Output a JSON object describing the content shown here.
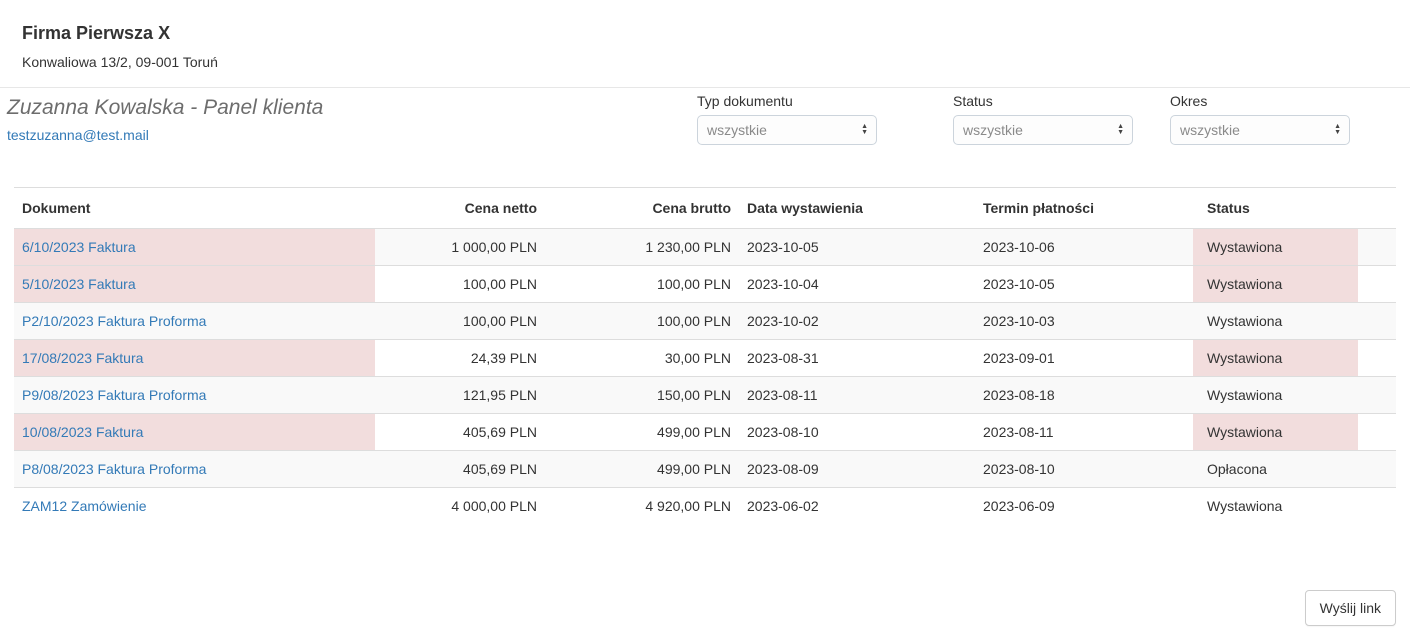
{
  "company": {
    "name": "Firma Pierwsza X",
    "address": "Konwaliowa 13/2, 09-001 Toruń"
  },
  "client": {
    "title": "Zuzanna Kowalska - Panel klienta",
    "email": "testzuzanna@test.mail"
  },
  "filters": [
    {
      "label": "Typ dokumentu",
      "value": "wszystkie"
    },
    {
      "label": "Status",
      "value": "wszystkie"
    },
    {
      "label": "Okres",
      "value": "wszystkie"
    }
  ],
  "table": {
    "columns": [
      "Dokument",
      "Cena netto",
      "Cena brutto",
      "Data wystawienia",
      "Termin płatności",
      "Status"
    ],
    "rows": [
      {
        "dokument": "6/10/2023 Faktura",
        "netto": "1 000,00 PLN",
        "brutto": "1 230,00 PLN",
        "wystawienie": "2023-10-05",
        "termin": "2023-10-06",
        "status": "Wystawiona",
        "overdue": true
      },
      {
        "dokument": "5/10/2023 Faktura",
        "netto": "100,00 PLN",
        "brutto": "100,00 PLN",
        "wystawienie": "2023-10-04",
        "termin": "2023-10-05",
        "status": "Wystawiona",
        "overdue": true
      },
      {
        "dokument": "P2/10/2023 Faktura Proforma",
        "netto": "100,00 PLN",
        "brutto": "100,00 PLN",
        "wystawienie": "2023-10-02",
        "termin": "2023-10-03",
        "status": "Wystawiona",
        "overdue": false
      },
      {
        "dokument": "17/08/2023 Faktura",
        "netto": "24,39 PLN",
        "brutto": "30,00 PLN",
        "wystawienie": "2023-08-31",
        "termin": "2023-09-01",
        "status": "Wystawiona",
        "overdue": true
      },
      {
        "dokument": "P9/08/2023 Faktura Proforma",
        "netto": "121,95 PLN",
        "brutto": "150,00 PLN",
        "wystawienie": "2023-08-11",
        "termin": "2023-08-18",
        "status": "Wystawiona",
        "overdue": false
      },
      {
        "dokument": "10/08/2023 Faktura",
        "netto": "405,69 PLN",
        "brutto": "499,00 PLN",
        "wystawienie": "2023-08-10",
        "termin": "2023-08-11",
        "status": "Wystawiona",
        "overdue": true
      },
      {
        "dokument": "P8/08/2023 Faktura Proforma",
        "netto": "405,69 PLN",
        "brutto": "499,00 PLN",
        "wystawienie": "2023-08-09",
        "termin": "2023-08-10",
        "status": "Opłacona",
        "overdue": false
      },
      {
        "dokument": "ZAM12 Zamówienie",
        "netto": "4 000,00 PLN",
        "brutto": "4 920,00 PLN",
        "wystawienie": "2023-06-02",
        "termin": "2023-06-09",
        "status": "Wystawiona",
        "overdue": false
      }
    ]
  },
  "actions": {
    "send_link": "Wyślij link"
  },
  "colors": {
    "link": "#337ab7",
    "overdue_bg": "#f2dddd",
    "stripe_bg": "#f9f9f9",
    "border": "#dddddd",
    "text": "#333333",
    "muted_heading": "#6d6d6d"
  }
}
